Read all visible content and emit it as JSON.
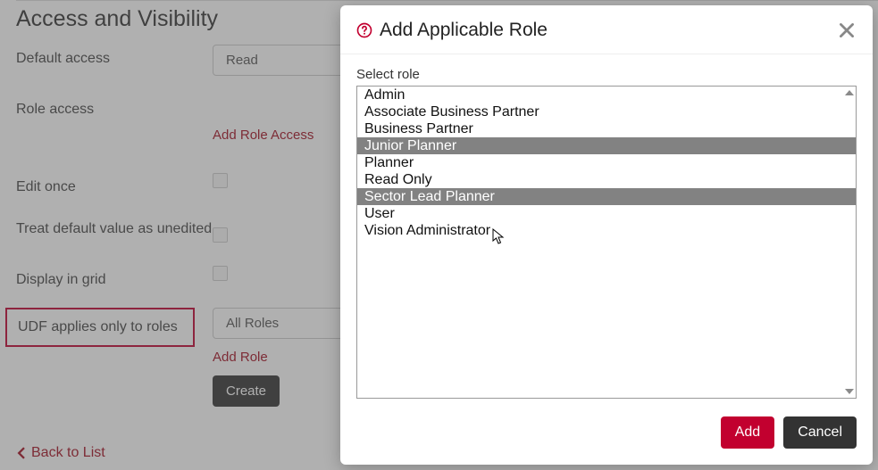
{
  "section": {
    "title": "Access and Visibility"
  },
  "form": {
    "default_access": {
      "label": "Default access",
      "value": "Read"
    },
    "role_access": {
      "label": "Role access",
      "add_link": "Add Role Access"
    },
    "edit_once": {
      "label": "Edit once"
    },
    "treat_default": {
      "label": "Treat default value as unedited"
    },
    "display_grid": {
      "label": "Display in grid"
    },
    "udf_roles": {
      "label": "UDF applies only to roles",
      "value": "All Roles",
      "add_link": "Add Role"
    },
    "create_btn": "Create"
  },
  "back_link": "Back to List",
  "modal": {
    "title": "Add Applicable Role",
    "field_label": "Select role",
    "options": [
      {
        "label": "Admin",
        "selected": false
      },
      {
        "label": "Associate Business Partner",
        "selected": false
      },
      {
        "label": "Business Partner",
        "selected": false
      },
      {
        "label": "Junior Planner",
        "selected": true
      },
      {
        "label": "Planner",
        "selected": false
      },
      {
        "label": "Read Only",
        "selected": false
      },
      {
        "label": "Sector Lead Planner",
        "selected": true
      },
      {
        "label": "User",
        "selected": false
      },
      {
        "label": "Vision Administrator",
        "selected": false
      }
    ],
    "add_btn": "Add",
    "cancel_btn": "Cancel"
  }
}
